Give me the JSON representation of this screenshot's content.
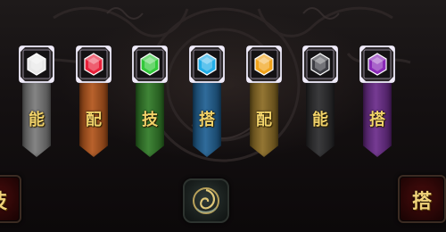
{
  "gems": [
    {
      "label": "能",
      "gem_color": "#e8e8e8",
      "banner_color": "#7a7a7a"
    },
    {
      "label": "配",
      "gem_color": "#e8203a",
      "banner_color": "#b2541a"
    },
    {
      "label": "技",
      "gem_color": "#32c83a",
      "banner_color": "#2f7a26"
    },
    {
      "label": "搭",
      "gem_color": "#22aee8",
      "banner_color": "#1e5f92"
    },
    {
      "label": "配",
      "gem_color": "#f0a21a",
      "banner_color": "#8a6a22"
    },
    {
      "label": "能",
      "gem_color": "#3e3e44",
      "banner_color": "#2a2a2c"
    },
    {
      "label": "搭",
      "gem_color": "#8a2ab8",
      "banner_color": "#6a2a8a"
    }
  ],
  "left_button": {
    "label": "技"
  },
  "right_button": {
    "label": "搭"
  },
  "center_button": {
    "icon": "swirl-emblem-icon"
  },
  "colors": {
    "gold_text": "#f2d36a",
    "side_button_red": "#4a0d0d"
  }
}
